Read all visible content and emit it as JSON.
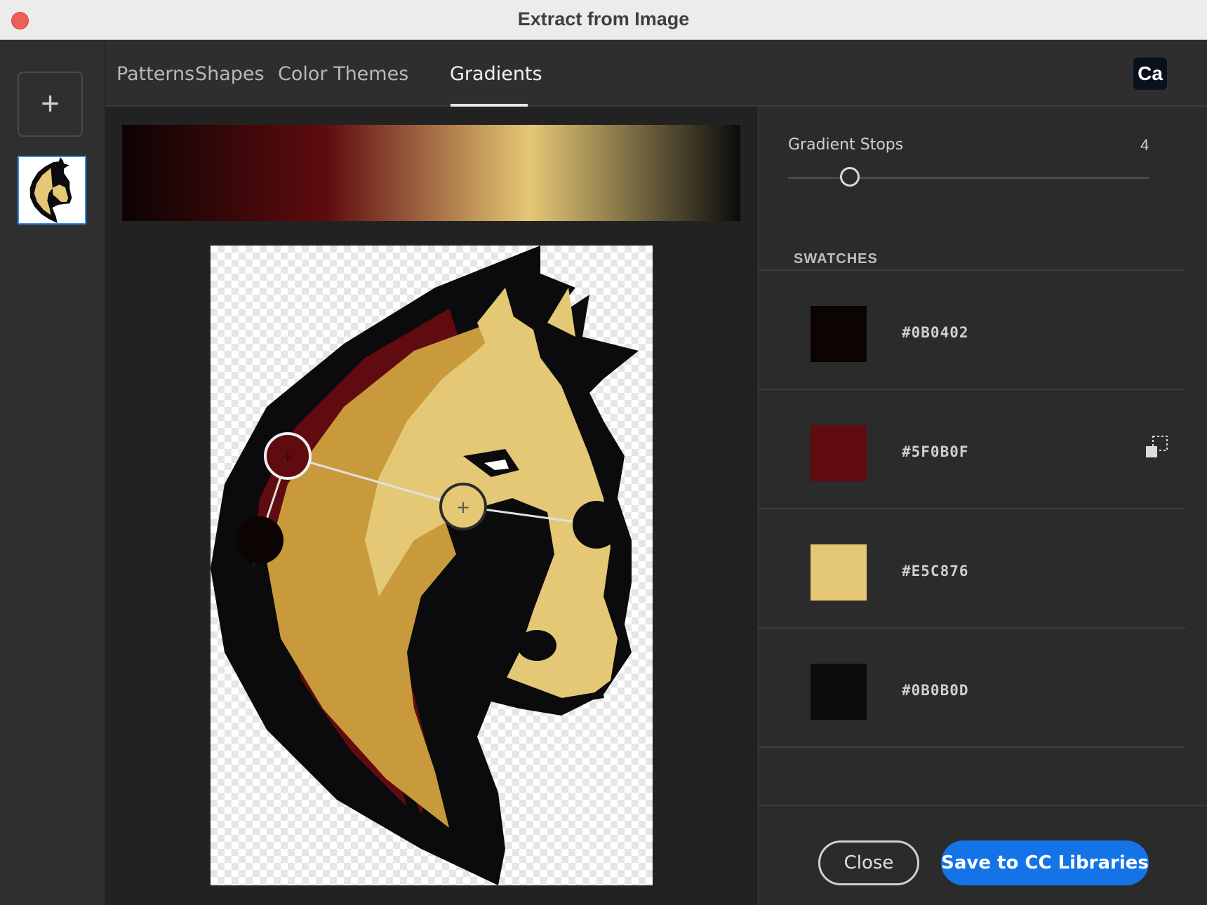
{
  "window": {
    "title": "Extract from Image"
  },
  "rail": {
    "add_label": "+"
  },
  "tabs": [
    {
      "label": "Patterns",
      "active": false
    },
    {
      "label": "Shapes",
      "active": false
    },
    {
      "label": "Color Themes",
      "active": false
    },
    {
      "label": "Gradients",
      "active": true
    }
  ],
  "badge": {
    "label": "Ca"
  },
  "gradient": {
    "stops_label": "Gradient Stops",
    "stops_value": "4",
    "slider_level": 0.2
  },
  "swatches": {
    "label": "SWATCHES",
    "items": [
      {
        "hex": "#0B0402",
        "color": "#0b0402"
      },
      {
        "hex": "#5F0B0F",
        "color": "#5f0b0f"
      },
      {
        "hex": "#E5C876",
        "color": "#e5c876"
      },
      {
        "hex": "#0B0B0D",
        "color": "#0b0b0d"
      }
    ]
  },
  "footer": {
    "close_label": "Close",
    "save_label": "Save to CC Libraries"
  },
  "colors": {
    "accent": "#1473e6",
    "dark_stop": "#0b0402",
    "maroon": "#5f0b0f",
    "gold": "#e5c876",
    "black": "#0b0b0d"
  }
}
